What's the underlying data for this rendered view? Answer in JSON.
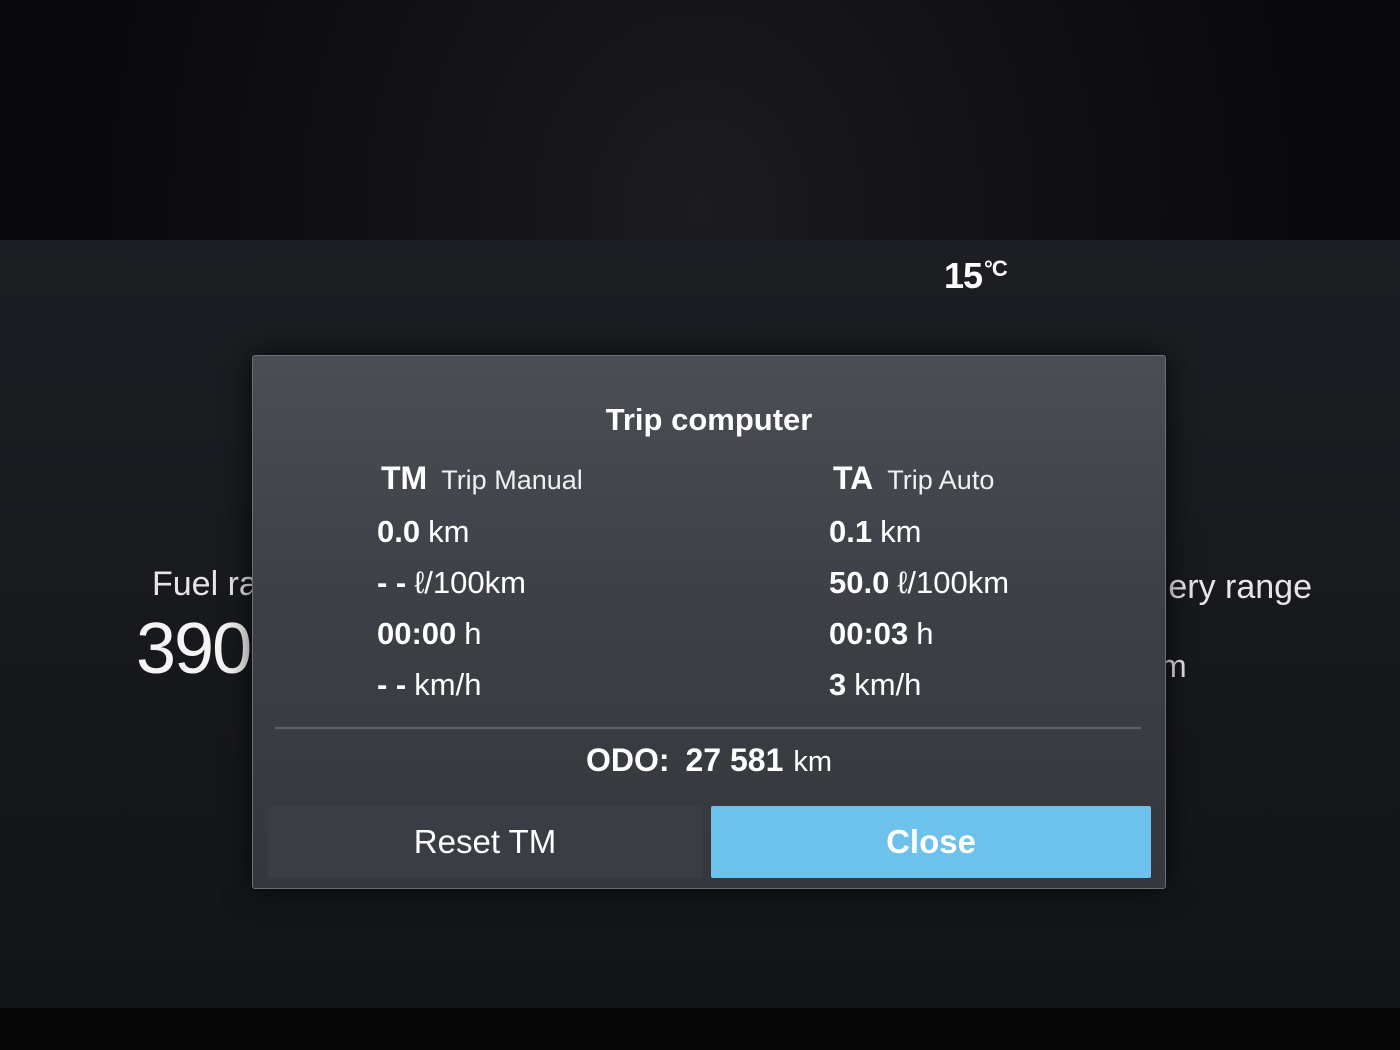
{
  "status": {
    "temperature_value": "15",
    "temperature_unit": "°C"
  },
  "background": {
    "fuel_label": "Fuel ra",
    "fuel_value": "390",
    "battery_label": "ery range",
    "battery_unit": "m"
  },
  "dialog": {
    "title": "Trip computer",
    "trip_manual": {
      "code": "TM",
      "name": "Trip Manual",
      "distance": {
        "value": "0.0",
        "unit": "km"
      },
      "consumption": {
        "value": "- -",
        "unit": "ℓ/100km"
      },
      "time": {
        "value": "00:00",
        "unit": "h"
      },
      "speed": {
        "value": "- -",
        "unit": "km/h"
      }
    },
    "trip_auto": {
      "code": "TA",
      "name": "Trip Auto",
      "distance": {
        "value": "0.1",
        "unit": "km"
      },
      "consumption": {
        "value": "50.0",
        "unit": "ℓ/100km"
      },
      "time": {
        "value": "00:03",
        "unit": "h"
      },
      "speed": {
        "value": "3",
        "unit": "km/h"
      }
    },
    "odo": {
      "label": "ODO:",
      "value": "27 581",
      "unit": "km"
    },
    "buttons": {
      "reset_label": "Reset TM",
      "close_label": "Close"
    }
  },
  "colors": {
    "accent": "#6cc2ea",
    "dialog_bg": "#3d4046",
    "screen_bg": "#17191d"
  }
}
